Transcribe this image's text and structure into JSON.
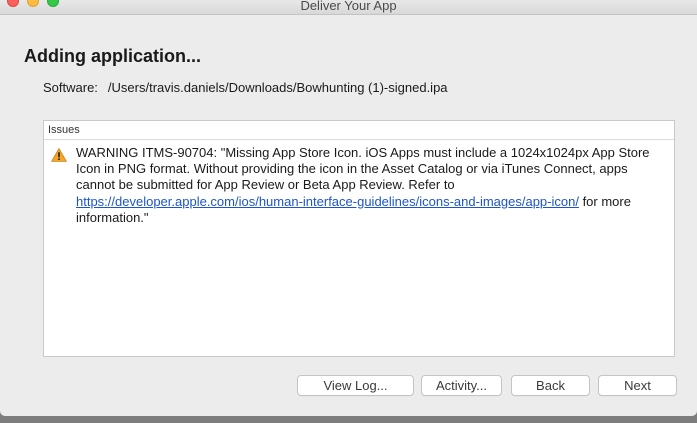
{
  "window": {
    "title": "Deliver Your App"
  },
  "main": {
    "heading": "Adding application...",
    "software_label": "Software:",
    "software_path": "/Users/travis.daniels/Downloads/Bowhunting (1)-signed.ipa"
  },
  "issues": {
    "header": "Issues",
    "items": [
      {
        "icon": "warning-icon",
        "text_before": "WARNING ITMS-90704: \"Missing App Store Icon. iOS Apps must include a 1024x1024px App Store Icon in PNG format. Without providing the icon in the Asset Catalog or via iTunes Connect, apps cannot be submitted for App Review or Beta App Review. Refer to ",
        "link": "https://developer.apple.com/ios/human-interface-guidelines/icons-and-images/app-icon/",
        "text_after": " for more information.\""
      }
    ]
  },
  "buttons": {
    "view_log": "View Log...",
    "activity": "Activity...",
    "back": "Back",
    "next": "Next"
  },
  "colors": {
    "link": "#1d55c9",
    "warning": "#f5a623",
    "close": "#fc605c",
    "minimize": "#fdbc40",
    "maximize": "#34c84a"
  }
}
